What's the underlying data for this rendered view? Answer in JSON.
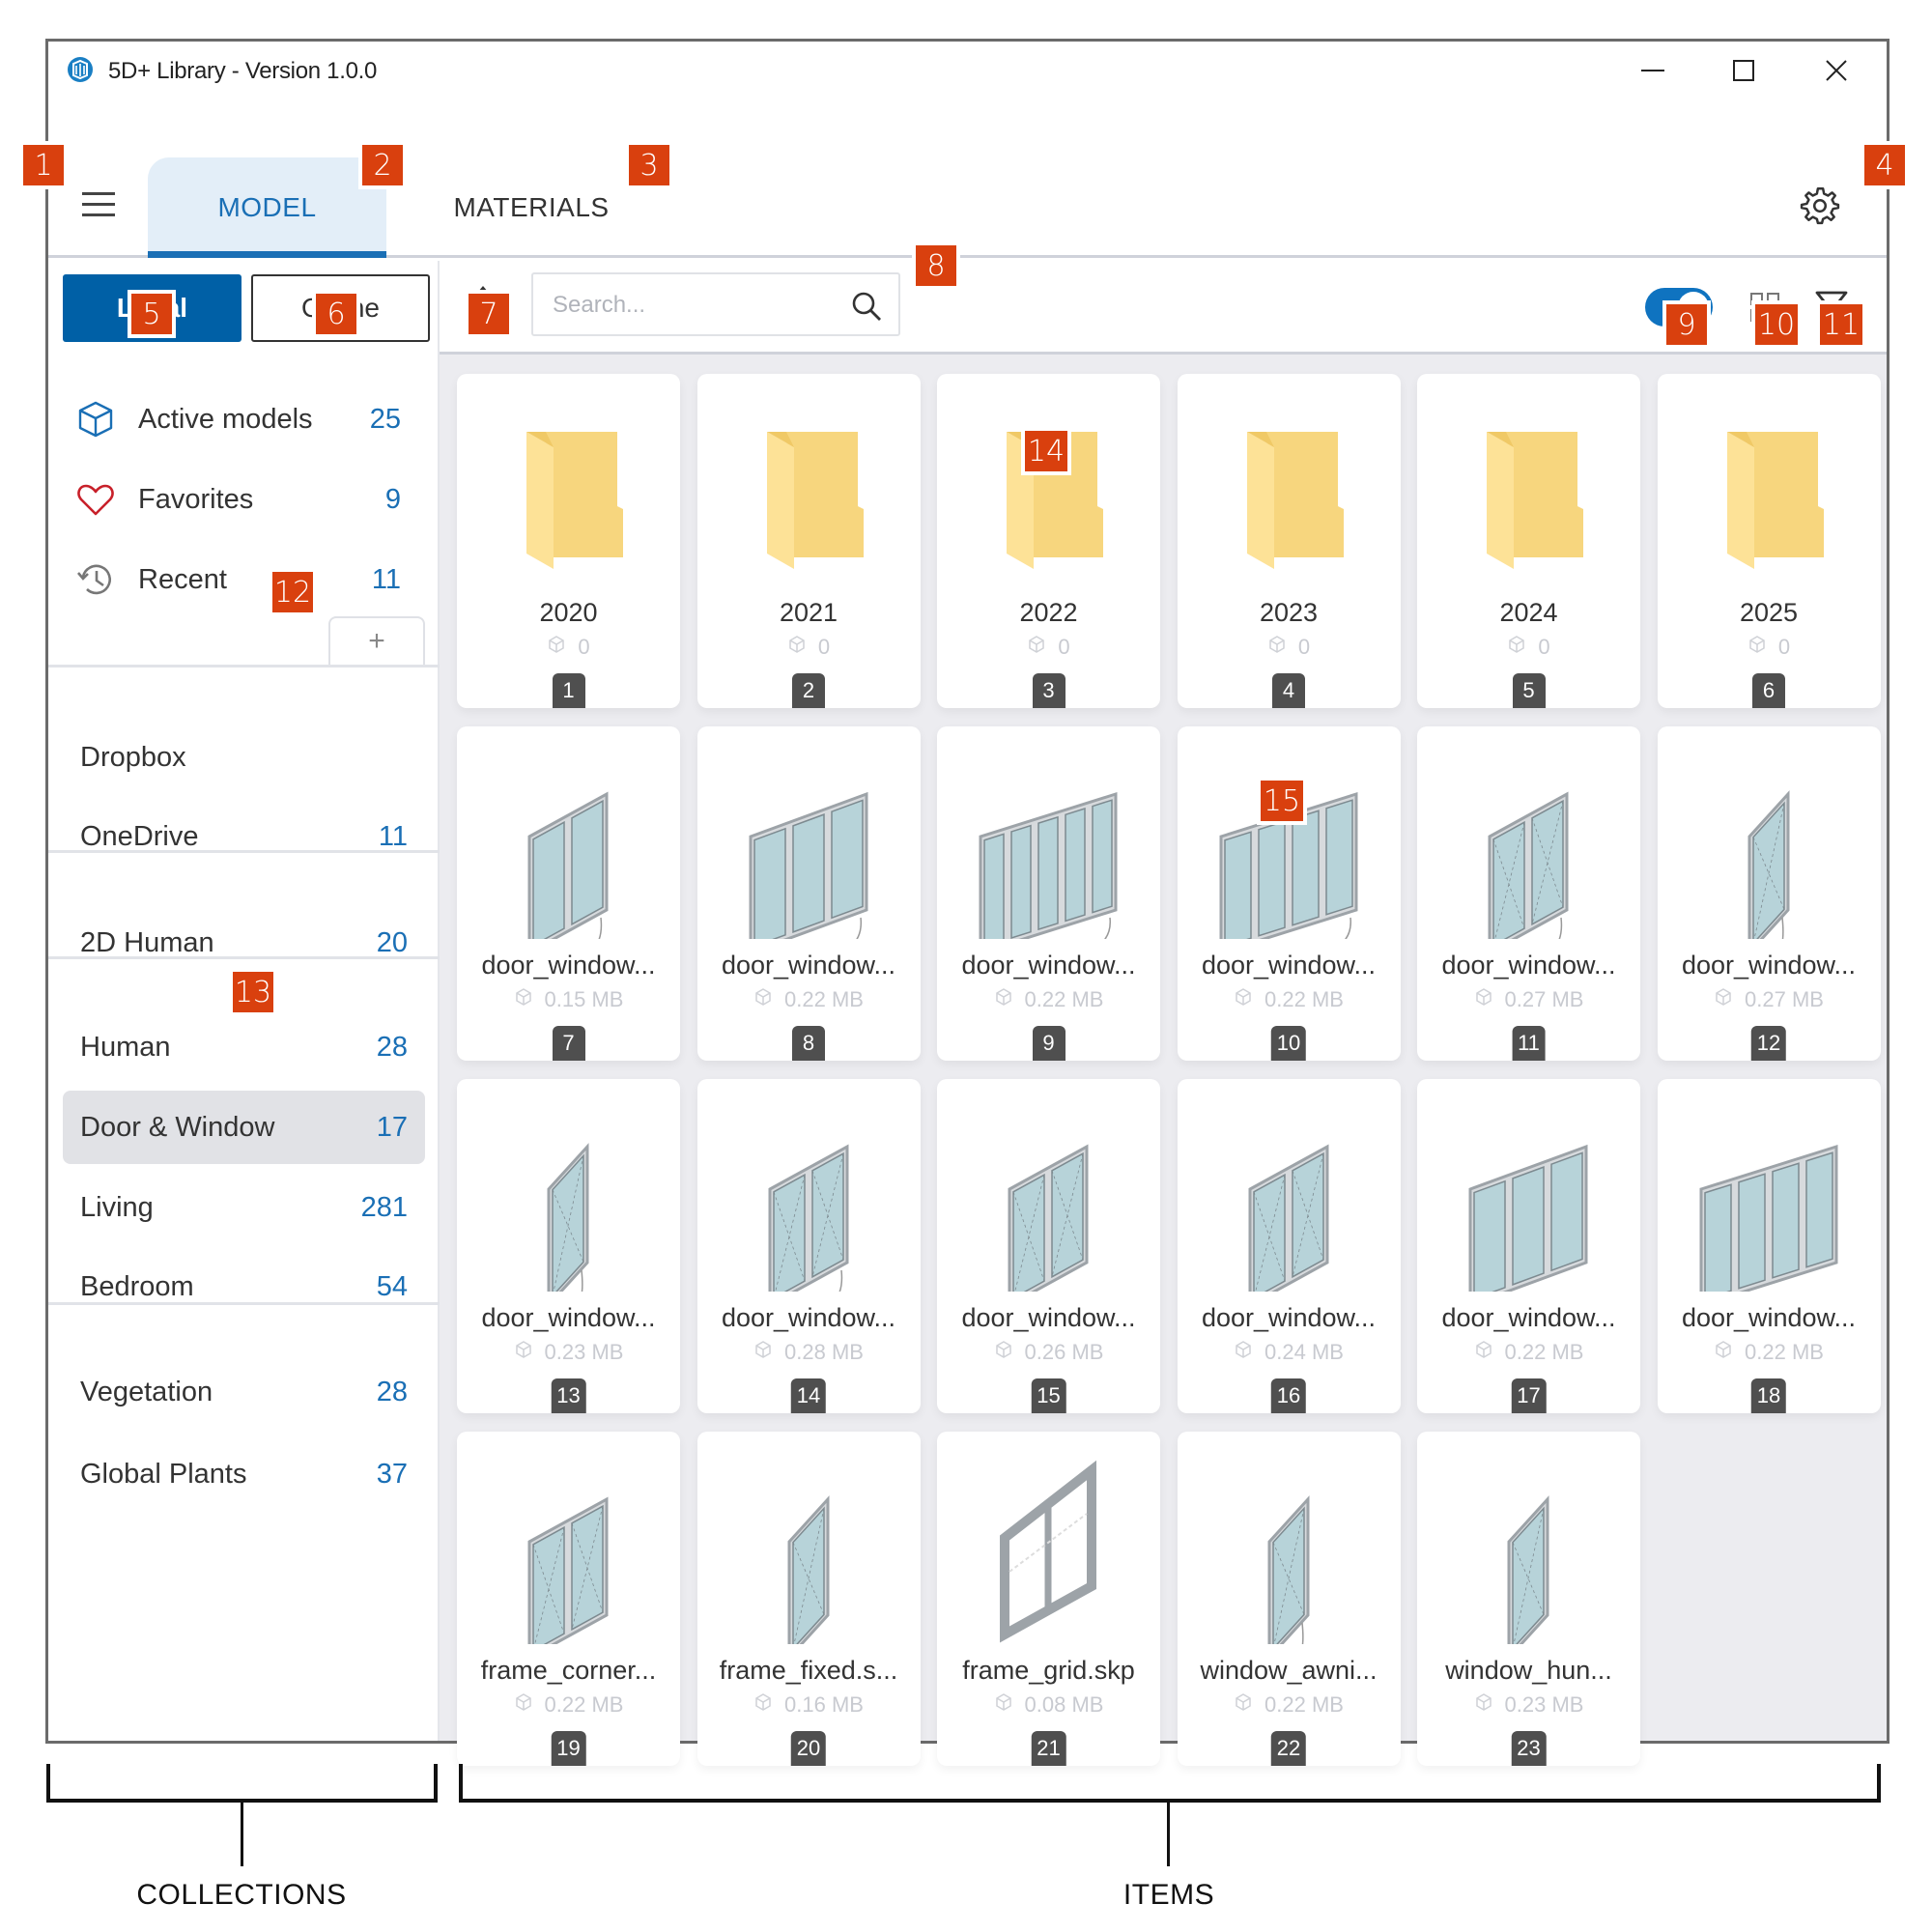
{
  "window": {
    "title": "5D+ Library - Version 1.0.0",
    "controls": {
      "minimize": "minimize",
      "maximize": "maximize",
      "close": "close"
    }
  },
  "tabs": [
    {
      "label": "MODEL",
      "active": true
    },
    {
      "label": "MATERIALS",
      "active": false
    }
  ],
  "sidebar": {
    "source_toggle": {
      "local": "Local",
      "online": "Online",
      "selected": "Local"
    },
    "quick_links": [
      {
        "label": "Active models",
        "count": "25",
        "icon": "cube-icon"
      },
      {
        "label": "Favorites",
        "count": "9",
        "icon": "heart-icon"
      },
      {
        "label": "Recent",
        "count": "11",
        "icon": "history-icon"
      }
    ],
    "add_label": "+",
    "collection_groups": [
      [
        {
          "label": "Dropbox",
          "count": ""
        },
        {
          "label": "OneDrive",
          "count": "11"
        }
      ],
      [
        {
          "label": "2D Human",
          "count": "20"
        }
      ],
      [
        {
          "label": "Human",
          "count": "28"
        },
        {
          "label": "Door & Window",
          "count": "17",
          "active": true
        },
        {
          "label": "Living",
          "count": "281"
        },
        {
          "label": "Bedroom",
          "count": "54"
        }
      ],
      [
        {
          "label": "Vegetation",
          "count": "28"
        },
        {
          "label": "Global Plants",
          "count": "37"
        }
      ]
    ]
  },
  "toolbar": {
    "search_placeholder": "Search...",
    "search_value": "",
    "toggle_on": true
  },
  "items": [
    {
      "index": "1",
      "name": "2020",
      "meta": "0",
      "type": "folder"
    },
    {
      "index": "2",
      "name": "2021",
      "meta": "0",
      "type": "folder"
    },
    {
      "index": "3",
      "name": "2022",
      "meta": "0",
      "type": "folder"
    },
    {
      "index": "4",
      "name": "2023",
      "meta": "0",
      "type": "folder"
    },
    {
      "index": "5",
      "name": "2024",
      "meta": "0",
      "type": "folder"
    },
    {
      "index": "6",
      "name": "2025",
      "meta": "0",
      "type": "folder"
    },
    {
      "index": "7",
      "name": "door_window...",
      "meta": "0.15 MB",
      "type": "door2"
    },
    {
      "index": "8",
      "name": "door_window...",
      "meta": "0.22 MB",
      "type": "door3"
    },
    {
      "index": "9",
      "name": "door_window...",
      "meta": "0.22 MB",
      "type": "door5"
    },
    {
      "index": "10",
      "name": "door_window...",
      "meta": "0.22 MB",
      "type": "door4"
    },
    {
      "index": "11",
      "name": "door_window...",
      "meta": "0.27 MB",
      "type": "door1s"
    },
    {
      "index": "12",
      "name": "door_window...",
      "meta": "0.27 MB",
      "type": "door1w"
    },
    {
      "index": "13",
      "name": "door_window...",
      "meta": "0.23 MB",
      "type": "single"
    },
    {
      "index": "14",
      "name": "door_window...",
      "meta": "0.28 MB",
      "type": "single2"
    },
    {
      "index": "15",
      "name": "door_window...",
      "meta": "0.26 MB",
      "type": "slide2"
    },
    {
      "index": "16",
      "name": "door_window...",
      "meta": "0.24 MB",
      "type": "slide2"
    },
    {
      "index": "17",
      "name": "door_window...",
      "meta": "0.22 MB",
      "type": "slide3"
    },
    {
      "index": "18",
      "name": "door_window...",
      "meta": "0.22 MB",
      "type": "slide4"
    },
    {
      "index": "19",
      "name": "frame_corner...",
      "meta": "0.22 MB",
      "type": "corner"
    },
    {
      "index": "20",
      "name": "frame_fixed.s...",
      "meta": "0.16 MB",
      "type": "fixed"
    },
    {
      "index": "21",
      "name": "frame_grid.skp",
      "meta": "0.08 MB",
      "type": "gridframe"
    },
    {
      "index": "22",
      "name": "window_awni...",
      "meta": "0.22 MB",
      "type": "awning"
    },
    {
      "index": "23",
      "name": "window_hun...",
      "meta": "0.23 MB",
      "type": "hung"
    }
  ],
  "callouts": [
    "1",
    "2",
    "3",
    "4",
    "5",
    "6",
    "7",
    "8",
    "9",
    "10",
    "11",
    "12",
    "13",
    "14",
    "15"
  ],
  "annotations": {
    "left": "COLLECTIONS",
    "right": "ITEMS"
  },
  "colors": {
    "accent": "#0060a6",
    "callout": "#d9400e",
    "count": "#1a6fb5"
  }
}
